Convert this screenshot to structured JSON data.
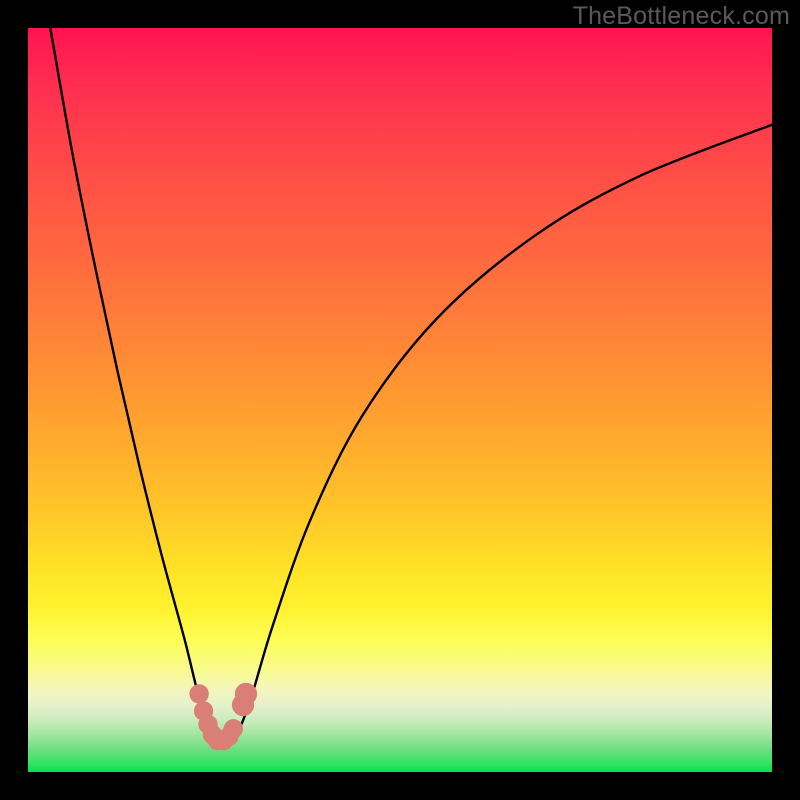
{
  "watermark": "TheBottleneck.com",
  "colors": {
    "frame": "#000000",
    "curve_stroke": "#000000",
    "marker_fill": "#da7f76",
    "gradient_top": "#ff1351",
    "gradient_bottom": "#04e04a"
  },
  "chart_data": {
    "type": "line",
    "title": "",
    "xlabel": "",
    "ylabel": "",
    "xlim": [
      0,
      100
    ],
    "ylim": [
      0,
      100
    ],
    "grid": false,
    "legend": false,
    "series": [
      {
        "name": "bottleneck-curve",
        "x": [
          3,
          6,
          9,
          12,
          15,
          18,
          21,
          23,
          24.5,
          25.5,
          26.5,
          27.5,
          28.5,
          30,
          33,
          38,
          45,
          55,
          68,
          82,
          100
        ],
        "y": [
          100,
          83,
          68,
          54,
          41,
          29,
          18,
          10,
          6,
          4,
          4,
          4.5,
          6,
          10,
          20,
          34,
          48,
          61,
          72,
          80,
          87
        ]
      }
    ],
    "markers": [
      {
        "x": 23.0,
        "y": 10.5,
        "r": 1.3
      },
      {
        "x": 23.6,
        "y": 8.2,
        "r": 1.3
      },
      {
        "x": 24.2,
        "y": 6.4,
        "r": 1.3
      },
      {
        "x": 24.8,
        "y": 5.0,
        "r": 1.3
      },
      {
        "x": 25.5,
        "y": 4.2,
        "r": 1.3
      },
      {
        "x": 26.3,
        "y": 4.2,
        "r": 1.3
      },
      {
        "x": 27.0,
        "y": 4.8,
        "r": 1.3
      },
      {
        "x": 27.6,
        "y": 5.8,
        "r": 1.3
      },
      {
        "x": 28.9,
        "y": 9.0,
        "r": 1.5
      },
      {
        "x": 29.3,
        "y": 10.5,
        "r": 1.5
      }
    ]
  }
}
